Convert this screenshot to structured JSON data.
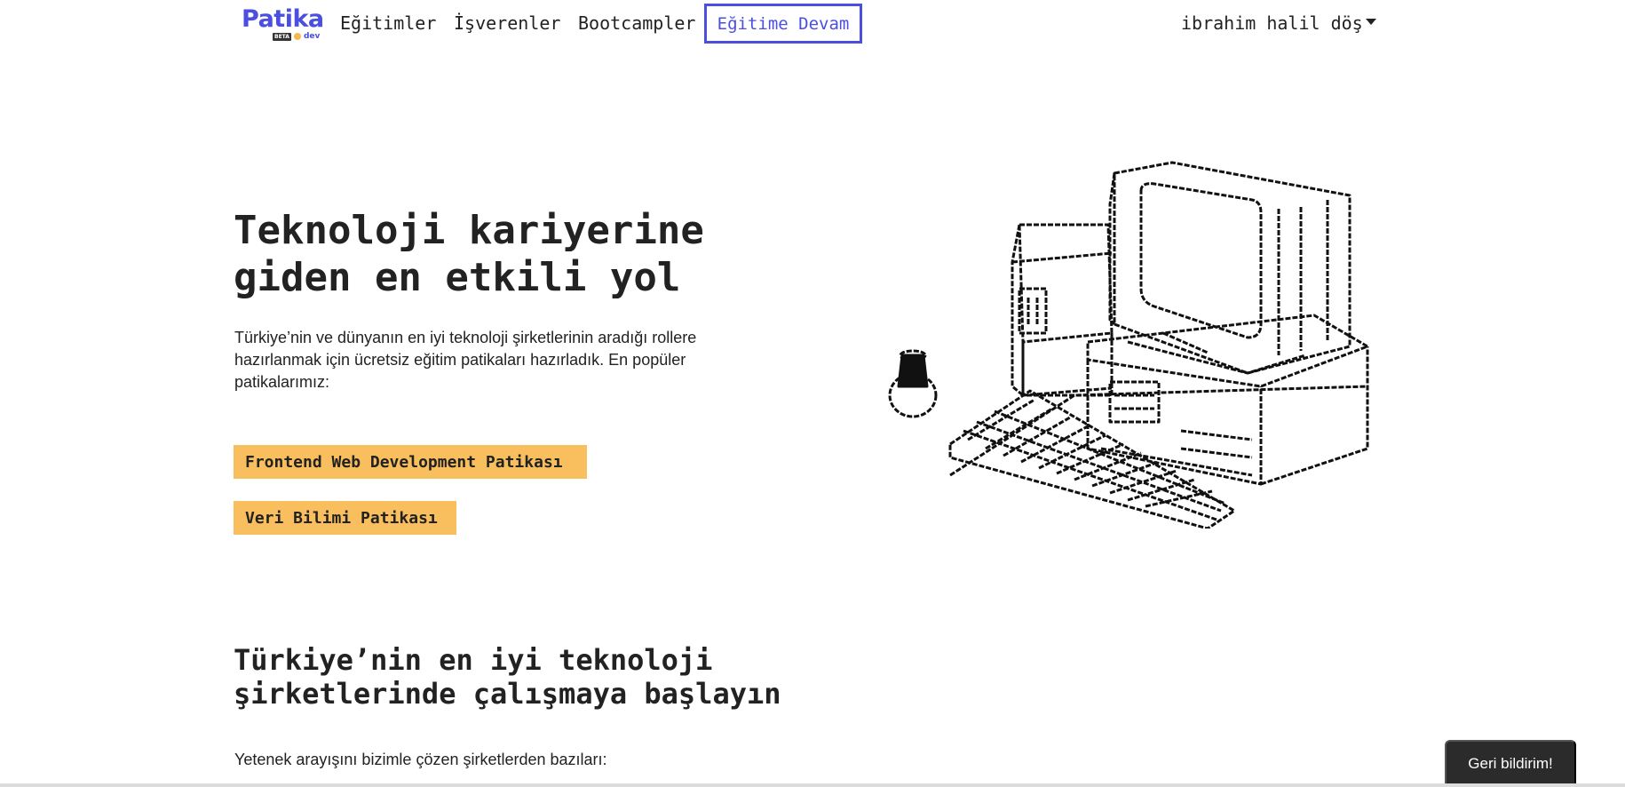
{
  "nav": {
    "logo_text": "Patika",
    "logo_badge": "BETA",
    "logo_suffix": "dev",
    "links": [
      "Eğitimler",
      "İşverenler",
      "Bootcampler"
    ],
    "cta": "Eğitime Devam",
    "user_name": "ibrahim halil döş",
    "accent_color": "#4a4fe0"
  },
  "hero": {
    "title_line1": "Teknoloji kariyerine",
    "title_line2": "giden en etkili yol",
    "description": "Türkiye’nin ve dünyanın en iyi teknoloji şirketlerinin aradığı rollere hazırlanmak için ücretsiz eğitim patikaları hazırladık. En popüler patikalarımız:",
    "paths": [
      "Frontend Web Development Patikası",
      "Veri Bilimi Patikası"
    ],
    "path_button_color": "#f9bf5e"
  },
  "companies": {
    "title_line1": "Türkiye’nin en iyi teknoloji",
    "title_line2": "şirketlerinde çalışmaya başlayın",
    "description": "Yetenek arayışını bizimle çözen şirketlerden bazıları:"
  },
  "feedback": {
    "label": "Geri bildirim!"
  }
}
